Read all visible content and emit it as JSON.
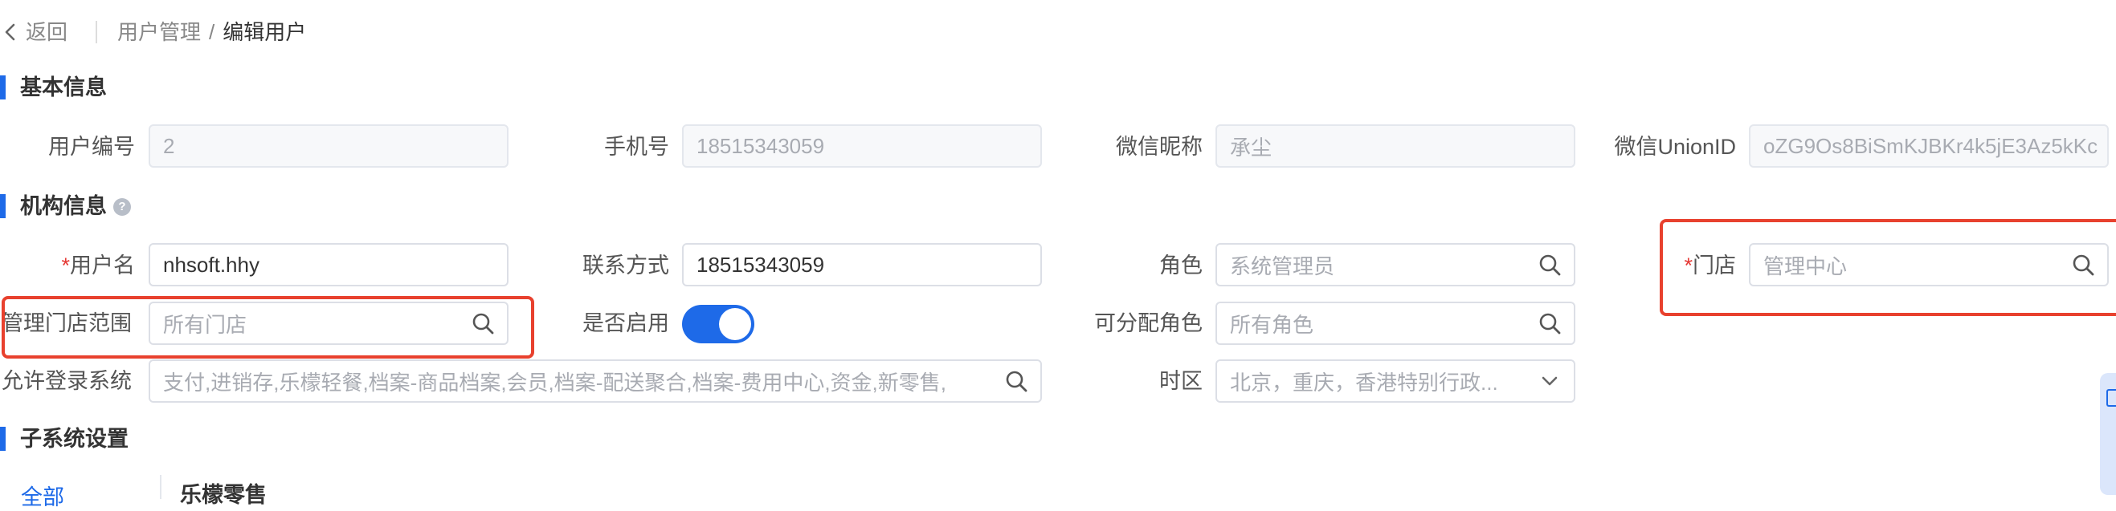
{
  "header": {
    "back_label": "返回",
    "breadcrumb": [
      "用户管理",
      "/",
      "编辑用户"
    ]
  },
  "sections": {
    "basic": "基本信息",
    "org": "机构信息",
    "subsystem": "子系统设置"
  },
  "basic": {
    "user_no": {
      "label": "用户编号",
      "value": "2"
    },
    "phone": {
      "label": "手机号",
      "value": "18515343059"
    },
    "wechat_nick": {
      "label": "微信昵称",
      "value": "承尘"
    },
    "wechat_union": {
      "label": "微信UnionID",
      "value": "oZG9Os8BiSmKJBKr4k5jE3Az5kKc"
    }
  },
  "org": {
    "username": {
      "required_mark": "*",
      "label": "用户名",
      "value": "nhsoft.hhy"
    },
    "contact": {
      "label": "联系方式",
      "value": "18515343059"
    },
    "role": {
      "label": "角色",
      "placeholder": "系统管理员"
    },
    "store": {
      "required_mark": "*",
      "label": "门店",
      "placeholder": "管理中心"
    },
    "store_scope": {
      "label": "管理门店范围",
      "placeholder": "所有门店"
    },
    "enabled": {
      "label": "是否启用",
      "value": true
    },
    "assignable_roles": {
      "label": "可分配角色",
      "placeholder": "所有角色"
    },
    "login_systems": {
      "label": "允许登录系统",
      "value": "支付,进销存,乐檬轻餐,档案-商品档案,会员,档案-配送聚合,档案-费用中心,资金,新零售,"
    },
    "timezone": {
      "label": "时区",
      "value": "北京，重庆，香港特别行政..."
    }
  },
  "subsystem_partial": {
    "left_tab": "全部",
    "title": "乐檬零售"
  },
  "icons": [
    "chevron-left-icon",
    "help-icon",
    "search-icon",
    "chevron-down-icon"
  ],
  "colors": {
    "accent": "#1e6ae8",
    "highlight": "#e8412e",
    "required": "#e53935"
  }
}
